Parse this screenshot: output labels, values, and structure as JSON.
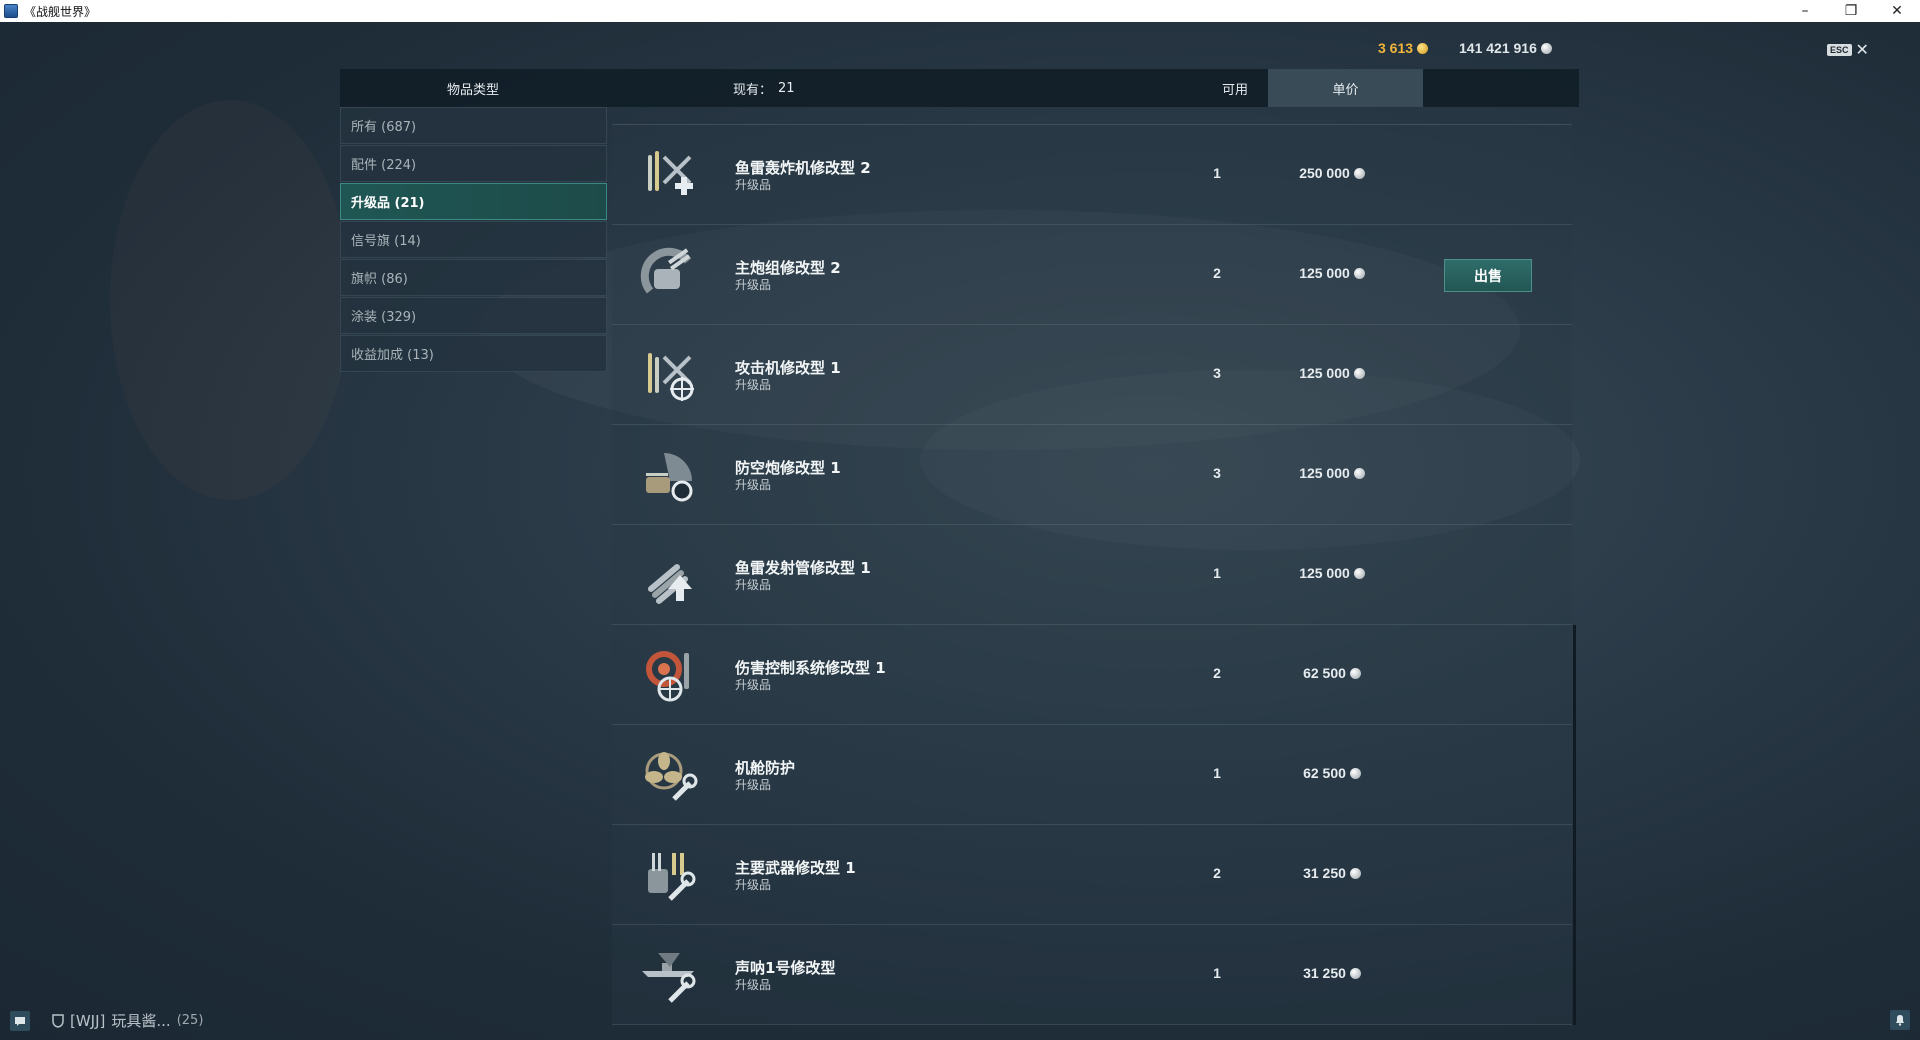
{
  "window": {
    "title": "《战舰世界》"
  },
  "currency": {
    "gold": "3 613",
    "silver": "141 421 916"
  },
  "header": {
    "item_type": "物品类型",
    "owned_label": "现有：",
    "owned_value": "21",
    "available": "可用",
    "unit_price": "单价"
  },
  "sidebar": {
    "items": [
      {
        "label": "所有 (687)"
      },
      {
        "label": "配件 (224)"
      },
      {
        "label": "升级品 (21)"
      },
      {
        "label": "信号旗 (14)"
      },
      {
        "label": "旗帜 (86)"
      },
      {
        "label": "涂装 (329)"
      },
      {
        "label": "收益加成 (13)"
      }
    ]
  },
  "items": [
    {
      "name": "鱼雷轰炸机修改型 2",
      "type": "升级品",
      "qty": "1",
      "price": "250 000",
      "icon": "torpedo-bomber-icon"
    },
    {
      "name": "主炮组修改型 2",
      "type": "升级品",
      "qty": "2",
      "price": "125 000",
      "icon": "main-battery-icon",
      "sell": "出售"
    },
    {
      "name": "攻击机修改型 1",
      "type": "升级品",
      "qty": "3",
      "price": "125 000",
      "icon": "attack-aircraft-icon"
    },
    {
      "name": "防空炮修改型 1",
      "type": "升级品",
      "qty": "3",
      "price": "125 000",
      "icon": "aa-gun-icon"
    },
    {
      "name": "鱼雷发射管修改型 1",
      "type": "升级品",
      "qty": "1",
      "price": "125 000",
      "icon": "torpedo-tubes-icon"
    },
    {
      "name": "伤害控制系统修改型 1",
      "type": "升级品",
      "qty": "2",
      "price": "62 500",
      "icon": "damage-control-icon"
    },
    {
      "name": "机舱防护",
      "type": "升级品",
      "qty": "1",
      "price": "62 500",
      "icon": "engine-protection-icon"
    },
    {
      "name": "主要武器修改型 1",
      "type": "升级品",
      "qty": "2",
      "price": "31 250",
      "icon": "main-armaments-icon"
    },
    {
      "name": "声呐1号修改型",
      "type": "升级品",
      "qty": "1",
      "price": "31 250",
      "icon": "hydroacoustic-icon"
    }
  ],
  "bottom": {
    "clan_tag": "[WJJ]",
    "player": "玩具酱...",
    "count": "(25)"
  },
  "esc": "ESC"
}
